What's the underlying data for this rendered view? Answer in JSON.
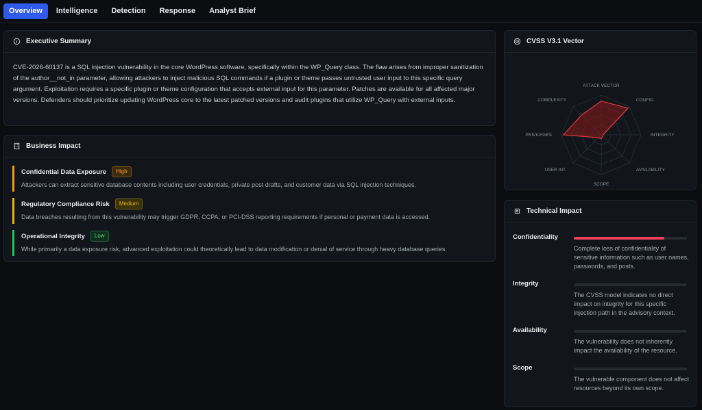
{
  "tabs": [
    "Overview",
    "Intelligence",
    "Detection",
    "Response",
    "Analyst Brief"
  ],
  "exec_summary": {
    "title": "Executive Summary",
    "text": "CVE-2026-60137 is a SQL injection vulnerability in the core WordPress software, specifically within the WP_Query class. The flaw arises from improper sanitization of the author__not_in parameter, allowing attackers to inject malicious SQL commands if a plugin or theme passes untrusted user input to this specific query argument. Exploitation requires a specific plugin or theme configuration that accepts external input for this parameter. Patches are available for all affected major versions. Defenders should prioritize updating WordPress core to the latest patched versions and audit plugins that utilize WP_Query with external inputs."
  },
  "business_impact": {
    "title": "Business Impact",
    "items": [
      {
        "title": "Confidential Data Exposure",
        "badge": "High",
        "color": "#f59e0b",
        "badge_bg": "#3a2a0e",
        "badge_fg": "#f5a524",
        "desc": "Attackers can extract sensitive database contents including user credentials, private post drafts, and customer data via SQL injection techniques."
      },
      {
        "title": "Regulatory Compliance Risk",
        "badge": "Medium",
        "color": "#eab308",
        "badge_bg": "#3a330c",
        "badge_fg": "#eab308",
        "desc": "Data breaches resulting from this vulnerability may trigger GDPR, CCPA, or PCI-DSS reporting requirements if personal or payment data is accessed."
      },
      {
        "title": "Operational Integrity",
        "badge": "Low",
        "color": "#22c55e",
        "badge_bg": "#10301c",
        "badge_fg": "#4ade80",
        "desc": "While primarily a data exposure risk, advanced exploitation could theoretically lead to data modification or denial of service through heavy database queries."
      }
    ]
  },
  "cvss": {
    "title": "CVSS V3.1 Vector",
    "axes": [
      "ATTACK VECTOR",
      "CONFID.",
      "INTEGRITY",
      "AVAILABILITY",
      "SCOPE",
      "USER INT.",
      "PRIVILEGES",
      "COMPLEXITY"
    ],
    "values": [
      0.85,
      0.95,
      0.05,
      0.05,
      0.1,
      0.1,
      0.95,
      0.7
    ],
    "fill": "#8b1a1a",
    "stroke": "#e03a3a"
  },
  "technical_impact": {
    "title": "Technical Impact",
    "items": [
      {
        "label": "Confidentiality",
        "level": 0.8,
        "text": "Complete loss of confidentiality of sensitive information such as user names, passwords, and posts."
      },
      {
        "label": "Integrity",
        "level": 0,
        "text": "The CVSS model indicates no direct impact on integrity for this specific injection path in the advisory context."
      },
      {
        "label": "Availability",
        "level": 0,
        "text": "The vulnerability does not inherently impact the availability of the resource."
      },
      {
        "label": "Scope",
        "level": 0,
        "text": "The vulnerable component does not affect resources beyond its own scope."
      }
    ]
  }
}
